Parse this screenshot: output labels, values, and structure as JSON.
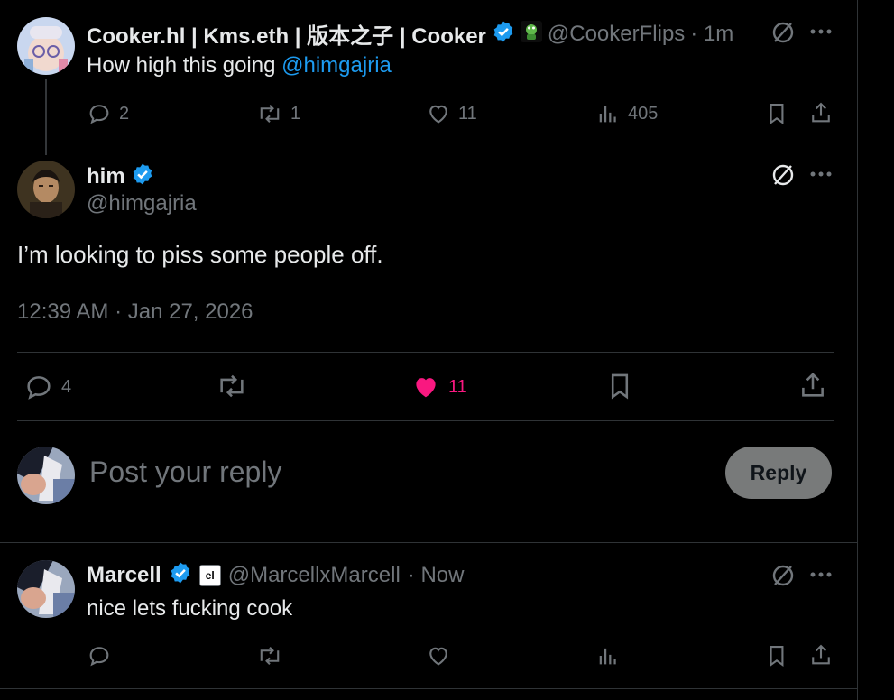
{
  "thread": {
    "parent": {
      "display_name": "Cooker.hl | Kms.eth | 版本之子 | Cooker",
      "handle": "@CookerFlips",
      "time": "· 1m",
      "text": "How high this going ",
      "mention": "@himgajria",
      "counts": {
        "replies": "2",
        "reposts": "1",
        "likes": "11",
        "views": "405"
      }
    },
    "main": {
      "display_name": "him",
      "handle": "@himgajria",
      "text": "I’m looking to piss some people off.",
      "timestamp": "12:39 AM · Jan 27, 2026",
      "counts": {
        "replies": "4",
        "likes": "11"
      },
      "liked_color": "#f91880"
    },
    "composer": {
      "placeholder": "Post your reply",
      "reply_label": "Reply"
    },
    "reply": {
      "display_name": "Marcell",
      "affiliate_badge": "el",
      "handle": "@MarcellxMarcell",
      "time": "· Now",
      "text": "nice lets fucking cook"
    }
  },
  "colors": {
    "accent": "#1d9bf0",
    "muted": "#71767b",
    "divider": "#2f3336",
    "like": "#f91880"
  },
  "icons": [
    "reply-icon",
    "repost-icon",
    "like-icon",
    "views-icon",
    "bookmark-icon",
    "share-icon",
    "grok-icon",
    "more-icon",
    "verified-icon"
  ]
}
